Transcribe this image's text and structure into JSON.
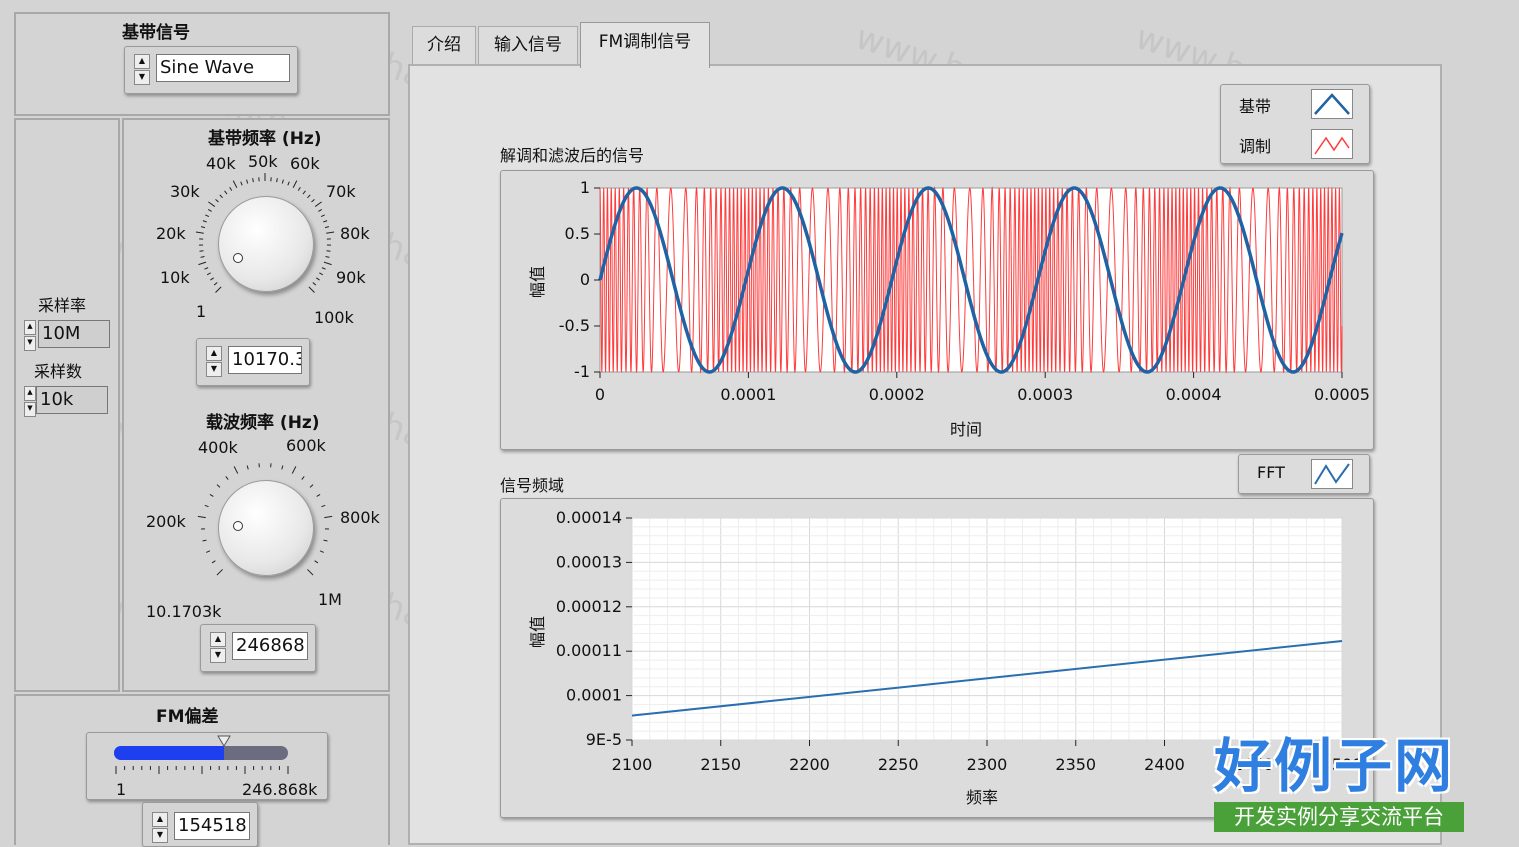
{
  "left": {
    "baseband_title": "基带信号",
    "baseband_value": "Sine Wave",
    "sample_rate_label": "采样率",
    "sample_rate_value": "10M",
    "sample_count_label": "采样数",
    "sample_count_value": "10k",
    "bb_freq_title": "基带频率 (Hz)",
    "bb_freq_ticks": [
      "1",
      "10k",
      "20k",
      "30k",
      "40k",
      "50k",
      "60k",
      "70k",
      "80k",
      "90k",
      "100k"
    ],
    "bb_freq_value": "10170.3",
    "carrier_title": "载波频率 (Hz)",
    "carrier_ticks": [
      "10.1703k",
      "200k",
      "400k",
      "600k",
      "800k",
      "1M"
    ],
    "carrier_value": "246868",
    "fm_dev_title": "FM偏差",
    "fm_dev_min": "1",
    "fm_dev_max": "246.868k",
    "fm_dev_fraction": 0.63,
    "fm_dev_value": "154518"
  },
  "tabs": [
    "介绍",
    "输入信号",
    "FM调制信号"
  ],
  "active_tab": "FM调制信号",
  "legend1": {
    "items": [
      "基带",
      "调制"
    ]
  },
  "legend2": {
    "items": [
      "FFT"
    ]
  },
  "colors": {
    "baseband": "#1f63a4",
    "modulated": "#ff3b3b",
    "fft": "#2a6eb0"
  },
  "chart_data": [
    {
      "type": "line",
      "title": "解调和滤波后的信号",
      "xlabel": "时间",
      "ylabel": "幅值",
      "xlim": [
        0,
        0.0005
      ],
      "ylim": [
        -1,
        1
      ],
      "xticks": [
        "0",
        "0.0001",
        "0.0002",
        "0.0003",
        "0.0004",
        "0.0005"
      ],
      "yticks": [
        "1",
        "0.5",
        "0",
        "-0.5",
        "-1"
      ],
      "series": [
        {
          "name": "基带",
          "function": "sin(2*pi*10170.3*t)",
          "x_range": [
            0,
            0.0005
          ]
        },
        {
          "name": "调制",
          "function": "FM carrier 246868 Hz, deviation 154518 Hz",
          "x_range": [
            0,
            0.0005
          ]
        }
      ]
    },
    {
      "type": "line",
      "title": "信号频域",
      "xlabel": "频率",
      "ylabel": "幅值",
      "xlim": [
        2100,
        2500
      ],
      "ylim": [
        9e-05,
        0.00014
      ],
      "xticks": [
        "2100",
        "2150",
        "2200",
        "2250",
        "2300",
        "2350",
        "2400",
        "2450",
        "2500"
      ],
      "yticks": [
        "0.00014",
        "0.00013",
        "0.00012",
        "0.00011",
        "0.0001",
        "9E-5"
      ],
      "grid": true,
      "series": [
        {
          "name": "FFT",
          "x": [
            2100,
            2500
          ],
          "y": [
            9.55e-05,
            0.0001123
          ]
        }
      ]
    }
  ],
  "watermark": {
    "text": "www.haolizi.com",
    "logo": "好例子网",
    "logo_sub": "开发实例分享交流平台"
  }
}
